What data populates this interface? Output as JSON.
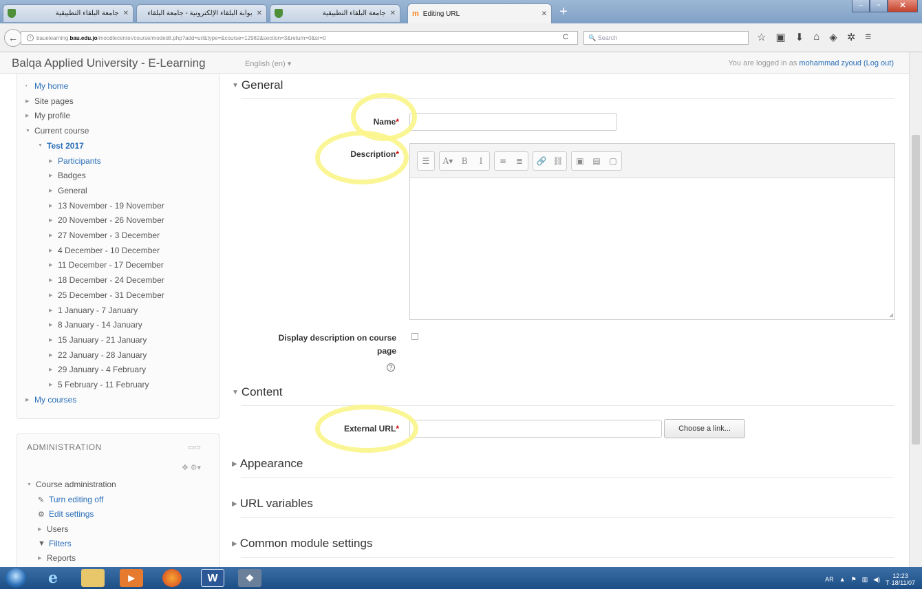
{
  "browser": {
    "tabs": [
      {
        "title": "جامعة البلقاء التطبيقية"
      },
      {
        "title": "بوابة البلقاء الإلكترونية - جامعة البلقاء"
      },
      {
        "title": "جامعة البلقاء التطبيقية"
      },
      {
        "title": "Editing URL"
      }
    ],
    "url_prefix": "bauelearning.",
    "url_domain": "bau.edu.jo",
    "url_path": "/moodlecenter/course/modedit.php?add=url&type=&course=12982&section=3&return=0&sr=0",
    "search_placeholder": "Search"
  },
  "header": {
    "site_name": "Balqa Applied University - E-Learning",
    "language": "English (en) ▾",
    "login_prefix": "You are logged in as ",
    "user_name": "mohammad zyoud",
    "logout": "(Log out)"
  },
  "navigation": {
    "items": [
      {
        "label": "My home",
        "marker": "•"
      },
      {
        "label": "Site pages",
        "marker": "▶"
      },
      {
        "label": "My profile",
        "marker": "▶"
      },
      {
        "label": "Current course",
        "marker": "▼"
      },
      {
        "label": "Test 2017",
        "marker": "▼"
      },
      {
        "label": "Participants",
        "marker": "▶"
      },
      {
        "label": "Badges",
        "marker": "▶"
      },
      {
        "label": "General",
        "marker": "▶"
      },
      {
        "label": "13 November - 19 November",
        "marker": "▶"
      },
      {
        "label": "20 November - 26 November",
        "marker": "▶"
      },
      {
        "label": "27 November - 3 December",
        "marker": "▶"
      },
      {
        "label": "4 December - 10 December",
        "marker": "▶"
      },
      {
        "label": "11 December - 17 December",
        "marker": "▶"
      },
      {
        "label": "18 December - 24 December",
        "marker": "▶"
      },
      {
        "label": "25 December - 31 December",
        "marker": "▶"
      },
      {
        "label": "1 January - 7 January",
        "marker": "▶"
      },
      {
        "label": "8 January - 14 January",
        "marker": "▶"
      },
      {
        "label": "15 January - 21 January",
        "marker": "▶"
      },
      {
        "label": "22 January - 28 January",
        "marker": "▶"
      },
      {
        "label": "29 January - 4 February",
        "marker": "▶"
      },
      {
        "label": "5 February - 11 February",
        "marker": "▶"
      },
      {
        "label": "My courses",
        "marker": "▶"
      }
    ]
  },
  "administration": {
    "title": "ADMINISTRATION",
    "items": [
      {
        "label": "Course administration"
      },
      {
        "label": "Turn editing off"
      },
      {
        "label": "Edit settings"
      },
      {
        "label": "Users"
      },
      {
        "label": "Filters"
      },
      {
        "label": "Reports"
      }
    ]
  },
  "form": {
    "general_heading": "General",
    "name_label": "Name",
    "description_label": "Description",
    "display_description_label_1": "Display description on course",
    "display_description_label_2": "page",
    "content_heading": "Content",
    "external_url_label": "External URL",
    "choose_link_button": "Choose a link...",
    "appearance_heading": "Appearance",
    "url_variables_heading": "URL variables",
    "common_settings_heading": "Common module settings",
    "required_marker": "*"
  },
  "editor_toolbar": [
    {
      "group": [
        "☰"
      ]
    },
    {
      "group": [
        "A▾",
        "B",
        "I"
      ]
    },
    {
      "group": [
        "≡",
        "≣"
      ]
    },
    {
      "group": [
        "🔗",
        "⛓"
      ]
    },
    {
      "group": [
        "▣",
        "▤",
        "▢"
      ]
    }
  ],
  "taskbar": {
    "lang": "AR",
    "time": "12:23",
    "date": "T·18/11/07"
  }
}
